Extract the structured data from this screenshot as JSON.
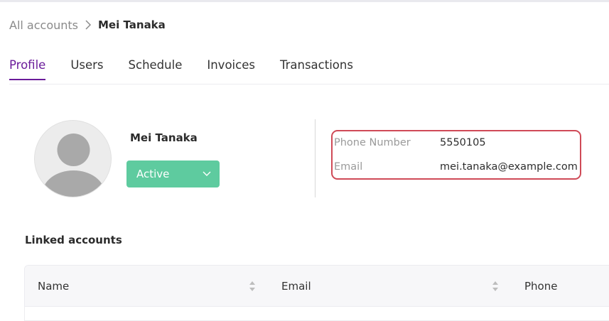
{
  "breadcrumb": {
    "root": "All accounts",
    "current": "Mei Tanaka"
  },
  "tabs": [
    {
      "label": "Profile",
      "active": true
    },
    {
      "label": "Users",
      "active": false
    },
    {
      "label": "Schedule",
      "active": false
    },
    {
      "label": "Invoices",
      "active": false
    },
    {
      "label": "Transactions",
      "active": false
    }
  ],
  "profile": {
    "name": "Mei Tanaka",
    "status": "Active",
    "status_color": "#5ecb9f"
  },
  "contact": {
    "phone_label": "Phone Number",
    "phone_value": "5550105",
    "email_label": "Email",
    "email_value": "mei.tanaka@example.com",
    "highlight_color": "#cf4a57"
  },
  "linked_accounts": {
    "title": "Linked accounts",
    "columns": [
      "Name",
      "Email",
      "Phone"
    ]
  },
  "colors": {
    "accent": "#6a1b9a"
  }
}
